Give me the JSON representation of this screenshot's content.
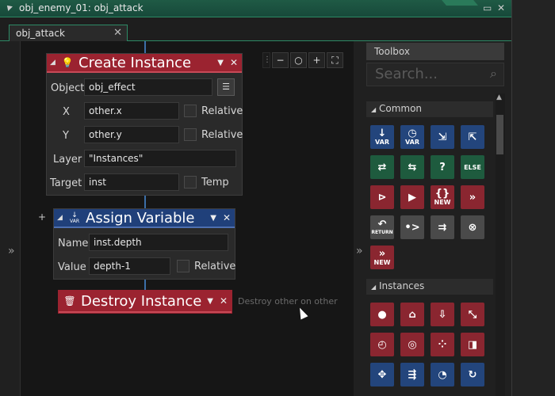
{
  "window": {
    "title": "obj_enemy_01: obj_attack",
    "maximize_glyph": "▭",
    "close_glyph": "✕"
  },
  "tabs": [
    {
      "label": "obj_attack",
      "close_glyph": "✕"
    }
  ],
  "canvas": {
    "left_chevron": "»",
    "right_chevron": "»",
    "zoom_controls": [
      "zoom-out-icon",
      "zoom-reset-icon",
      "zoom-in-icon",
      "fit-screen-icon"
    ]
  },
  "blocks": {
    "create_instance": {
      "title": "Create Instance",
      "color": "#9b2330",
      "object_label": "Object",
      "object_value": "obj_effect",
      "x_label": "X",
      "x_value": "other.x",
      "x_relative": "Relative",
      "y_label": "Y",
      "y_value": "other.y",
      "y_relative": "Relative",
      "layer_label": "Layer",
      "layer_value": "\"Instances\"",
      "target_label": "Target",
      "target_value": "inst",
      "temp_label": "Temp"
    },
    "assign_variable": {
      "title": "Assign Variable",
      "color": "#20407a",
      "icon_text": "VAR",
      "name_label": "Name",
      "name_value": "inst.depth",
      "value_label": "Value",
      "value_value": "depth-1",
      "relative_label": "Relative",
      "add_glyph": "+"
    },
    "destroy_instance": {
      "title": "Destroy Instance",
      "color": "#9b2330",
      "comment": "Destroy other on other"
    }
  },
  "toolbox": {
    "title": "Toolbox",
    "search_placeholder": "Search...",
    "sections": [
      {
        "label": "Common",
        "tools": [
          {
            "name": "declare-temp-var",
            "color": "blue",
            "glyph": "↓",
            "text": "VAR"
          },
          {
            "name": "assign-var",
            "color": "blue",
            "glyph": "◷",
            "text": "VAR"
          },
          {
            "name": "get-global",
            "color": "blue",
            "glyph": "⇲",
            "text": ""
          },
          {
            "name": "set-global",
            "color": "blue",
            "glyph": "⇱",
            "text": ""
          },
          {
            "name": "if-var",
            "color": "green",
            "glyph": "⇄",
            "text": ""
          },
          {
            "name": "if-expression",
            "color": "green",
            "glyph": "⇆",
            "text": ""
          },
          {
            "name": "if-undefined",
            "color": "green",
            "glyph": "?",
            "text": ""
          },
          {
            "name": "else",
            "color": "green",
            "glyph": "",
            "text": "ELSE"
          },
          {
            "name": "function-call",
            "color": "red",
            "glyph": "⊳",
            "text": ""
          },
          {
            "name": "execute-script",
            "color": "red",
            "glyph": "▶",
            "text": ""
          },
          {
            "name": "new-struct",
            "color": "red",
            "glyph": "{}",
            "text": "NEW"
          },
          {
            "name": "continue",
            "color": "red",
            "glyph": "»",
            "text": ""
          },
          {
            "name": "return",
            "color": "gray",
            "glyph": "↶",
            "text": "RETURN"
          },
          {
            "name": "execute-code",
            "color": "gray",
            "glyph": "•>",
            "text": ""
          },
          {
            "name": "switch",
            "color": "gray",
            "glyph": "⇉",
            "text": ""
          },
          {
            "name": "exit-event",
            "color": "gray",
            "glyph": "⊗",
            "text": ""
          },
          {
            "name": "new-constructor",
            "color": "red",
            "glyph": "»",
            "text": "NEW"
          }
        ]
      },
      {
        "label": "Instances",
        "tools": [
          {
            "name": "create-instance",
            "color": "red",
            "glyph": "●",
            "text": ""
          },
          {
            "name": "destroy-instance",
            "color": "red",
            "glyph": "⌂",
            "text": ""
          },
          {
            "name": "destroy-at-position",
            "color": "red",
            "glyph": "⇩",
            "text": ""
          },
          {
            "name": "change-instance",
            "color": "red",
            "glyph": "⤡",
            "text": ""
          },
          {
            "name": "alarm",
            "color": "red",
            "glyph": "◴",
            "text": ""
          },
          {
            "name": "instance-target",
            "color": "red",
            "glyph": "◎",
            "text": ""
          },
          {
            "name": "instance-count",
            "color": "red",
            "glyph": "⁘",
            "text": ""
          },
          {
            "name": "get-instance",
            "color": "red",
            "glyph": "◨",
            "text": ""
          },
          {
            "name": "movement-free",
            "color": "blue",
            "glyph": "✥",
            "text": ""
          },
          {
            "name": "movement-jump",
            "color": "blue",
            "glyph": "⇶",
            "text": ""
          },
          {
            "name": "set-direction",
            "color": "blue",
            "glyph": "◔",
            "text": ""
          },
          {
            "name": "set-speed",
            "color": "blue",
            "glyph": "↻",
            "text": ""
          }
        ]
      }
    ]
  }
}
